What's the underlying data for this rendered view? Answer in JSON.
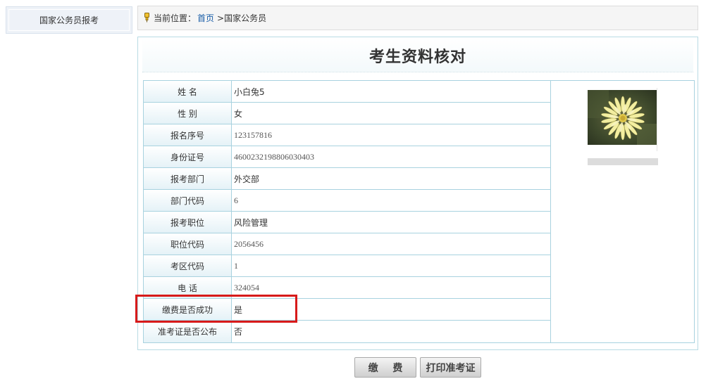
{
  "sidebar": {
    "items": [
      {
        "label": "国家公务员报考"
      }
    ]
  },
  "breadcrumb": {
    "prefix": "当前位置：",
    "home": "首页",
    "current": ">国家公务员"
  },
  "panel": {
    "title": "考生资料核对"
  },
  "rows": [
    {
      "label": "姓  名",
      "value": "小白兔5"
    },
    {
      "label": "性  别",
      "value": "女"
    },
    {
      "label": "报名序号",
      "value": "123157816"
    },
    {
      "label": "身份证号",
      "value": "4600232198806030403"
    },
    {
      "label": "报考部门",
      "value": "外交部"
    },
    {
      "label": "部门代码",
      "value": "6"
    },
    {
      "label": "报考职位",
      "value": "风险管理"
    },
    {
      "label": "职位代码",
      "value": "2056456"
    },
    {
      "label": "考区代码",
      "value": "1"
    },
    {
      "label": "电  话",
      "value": "324054"
    },
    {
      "label": "缴费是否成功",
      "value": "是"
    },
    {
      "label": "准考证是否公布",
      "value": "否"
    }
  ],
  "photo": {
    "icon": "flower-photo"
  },
  "buttons": {
    "pay": "缴 费",
    "print": "打印准考证"
  },
  "colors": {
    "highlight": "#d71a1a",
    "link": "#1a5ea8",
    "table_border": "#a8d2df"
  }
}
